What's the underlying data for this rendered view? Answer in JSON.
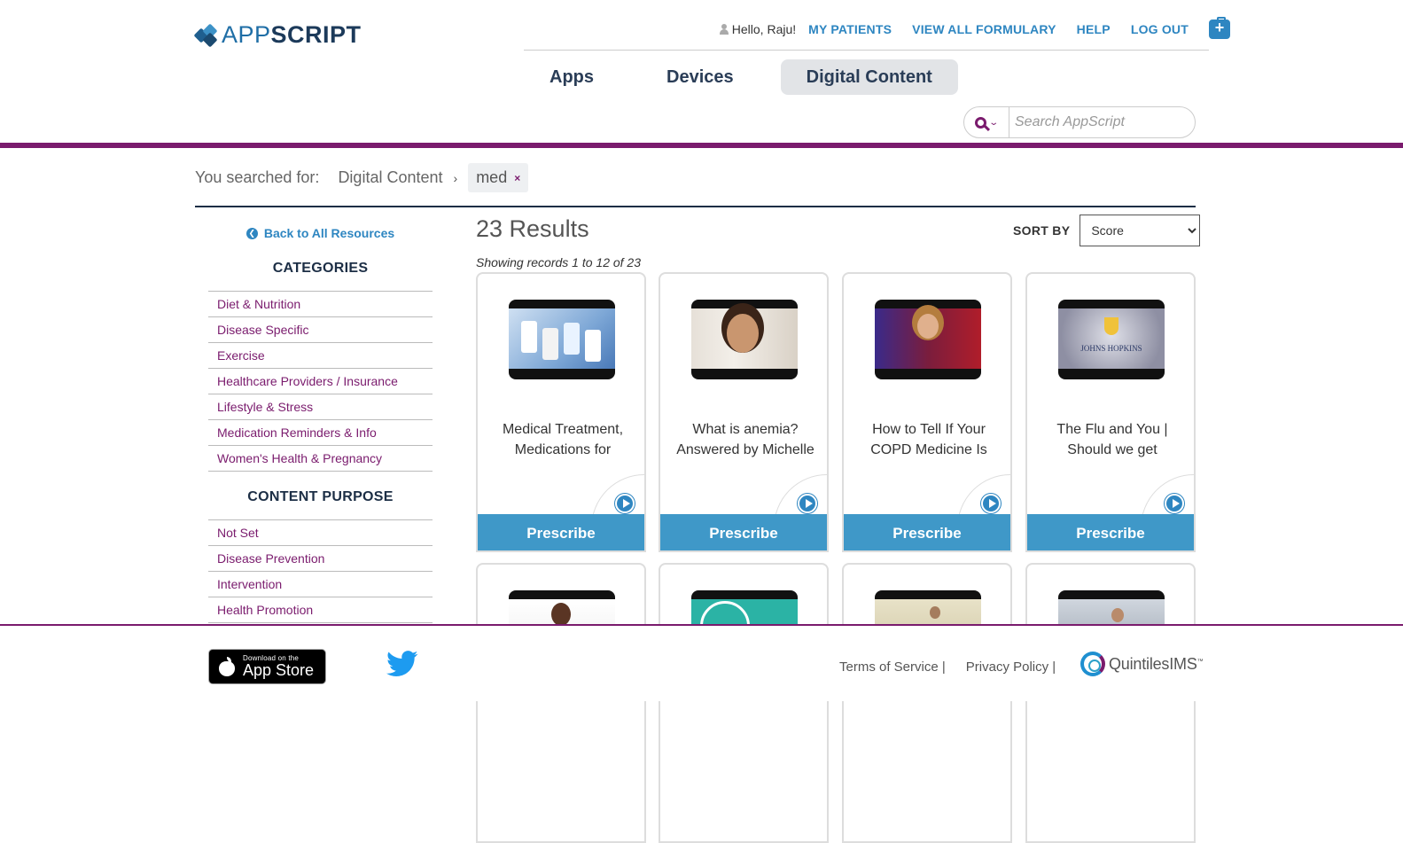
{
  "header": {
    "logo": {
      "part1": "APP",
      "part2": "SCRIPT"
    },
    "greeting": "Hello, Raju!",
    "links": [
      "MY PATIENTS",
      "VIEW ALL FORMULARY",
      "HELP",
      "LOG OUT"
    ],
    "tabs": [
      {
        "label": "Apps",
        "active": false
      },
      {
        "label": "Devices",
        "active": false
      },
      {
        "label": "Digital Content",
        "active": true
      }
    ],
    "search": {
      "placeholder": "Search AppScript",
      "value": ""
    }
  },
  "breadcrumb": {
    "label": "You searched for:",
    "category": "Digital Content",
    "term": "med",
    "remove_icon": "×"
  },
  "sidebar": {
    "back_label": "Back to All Resources",
    "categories_heading": "CATEGORIES",
    "categories": [
      "Diet & Nutrition",
      "Disease Specific",
      "Exercise",
      "Healthcare Providers / Insurance",
      "Lifestyle & Stress",
      "Medication Reminders & Info",
      "Women's Health & Pregnancy"
    ],
    "purpose_heading": "CONTENT PURPOSE",
    "purposes": [
      "Not Set",
      "Disease Prevention",
      "Intervention",
      "Health Promotion"
    ]
  },
  "results": {
    "title": "23 Results",
    "showing": "Showing records 1 to 12 of 23",
    "sort_label": "SORT BY",
    "sort_value": "Score",
    "prescribe_label": "Prescribe",
    "cards": [
      {
        "title": "Medical Treatment, Medications for",
        "thumb": "medication-bottles-thumbnail"
      },
      {
        "title": "What is anemia? Answered by Michelle",
        "thumb": "doctor-portrait-thumbnail"
      },
      {
        "title": "How to Tell If Your COPD Medicine Is",
        "thumb": "nurse-jen-thumbnail"
      },
      {
        "title": "The Flu and You | Should we get",
        "thumb": "johns-hopkins-thumbnail"
      },
      {
        "title": "",
        "thumb": "presenter-thumbnail"
      },
      {
        "title": "",
        "thumb": "teal-graphic-thumbnail"
      },
      {
        "title": "",
        "thumb": "hallway-thumbnail"
      },
      {
        "title": "",
        "thumb": "clinic-thumbnail"
      }
    ]
  },
  "footer": {
    "appstore_small": "Download on the",
    "appstore_big": "App Store",
    "links": [
      "Terms of Service |",
      "Privacy Policy |"
    ],
    "partner": "QuintilesIMS",
    "partner_tm": "™"
  },
  "colors": {
    "brand_purple": "#7a1b6d",
    "link_blue": "#2e86c1",
    "prescribe_blue": "#3f98c8",
    "navy": "#1c2e45"
  }
}
